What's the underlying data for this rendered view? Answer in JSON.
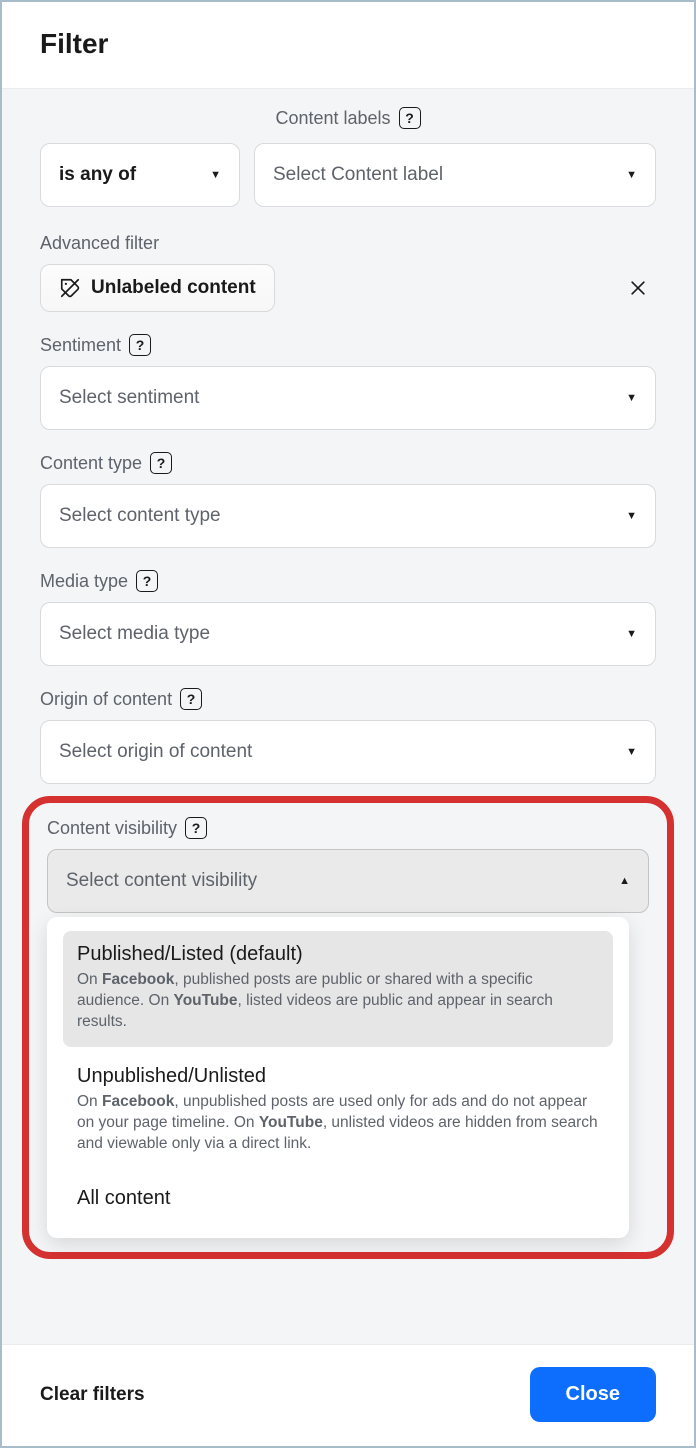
{
  "header": {
    "title": "Filter"
  },
  "content_labels": {
    "label": "Content labels",
    "operator": "is any of",
    "placeholder": "Select Content label"
  },
  "advanced_filter": {
    "label": "Advanced filter",
    "chip_label": "Unlabeled content"
  },
  "sentiment": {
    "label": "Sentiment",
    "placeholder": "Select sentiment"
  },
  "content_type": {
    "label": "Content type",
    "placeholder": "Select content type"
  },
  "media_type": {
    "label": "Media type",
    "placeholder": "Select media type"
  },
  "origin": {
    "label": "Origin of content",
    "placeholder": "Select origin of content"
  },
  "visibility": {
    "label": "Content visibility",
    "placeholder": "Select content visibility",
    "options": [
      {
        "title": "Published/Listed (default)",
        "desc_pre": "On ",
        "desc_b1": "Facebook",
        "desc_mid": ", published posts are public or shared with a specific audience. On ",
        "desc_b2": "YouTube",
        "desc_post": ", listed videos are public and appear in search results."
      },
      {
        "title": "Unpublished/Unlisted",
        "desc_pre": "On ",
        "desc_b1": "Facebook",
        "desc_mid": ", unpublished posts are used only for ads and do not appear on your page timeline. On ",
        "desc_b2": "YouTube",
        "desc_post": ", unlisted videos are hidden from search and viewable only via a direct link."
      },
      {
        "title": "All content"
      }
    ]
  },
  "footer": {
    "clear": "Clear filters",
    "close": "Close"
  }
}
